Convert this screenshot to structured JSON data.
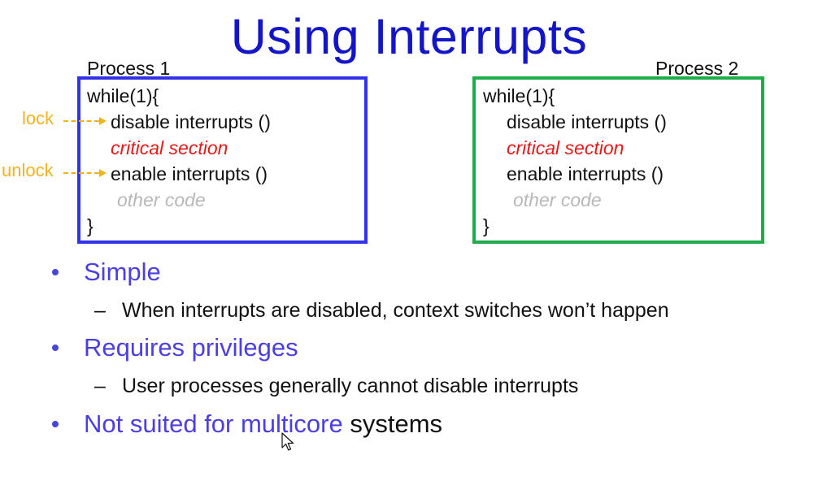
{
  "title": "Using Interrupts",
  "process1": {
    "label": "Process 1",
    "lines": [
      "while(1){",
      "disable interrupts ()",
      "critical section",
      "enable interrupts ()",
      "other code",
      "}"
    ],
    "annotations": {
      "lock": "lock",
      "unlock": "unlock"
    }
  },
  "process2": {
    "label": "Process 2",
    "lines": [
      "while(1){",
      "disable interrupts ()",
      "critical section",
      "enable interrupts ()",
      "other code",
      "}"
    ]
  },
  "bullets": [
    {
      "text": "Simple",
      "sub": "When interrupts are disabled, context switches won’t happen"
    },
    {
      "text": "Requires privileges",
      "sub": "User processes generally cannot disable interrupts"
    },
    {
      "text": "Not suited for multicore",
      "suffix": " systems"
    }
  ],
  "dash_symbol": "–",
  "colors": {
    "title": "#1414c8",
    "box1_border": "#3232e6",
    "box2_border": "#1fad4a",
    "critical": "#e11b1b",
    "other_code": "#b8b8b8",
    "annotation": "#f0b31d",
    "bullet_text": "#4c3fe0"
  },
  "icons": {
    "cursor": "mouse-pointer-icon"
  }
}
